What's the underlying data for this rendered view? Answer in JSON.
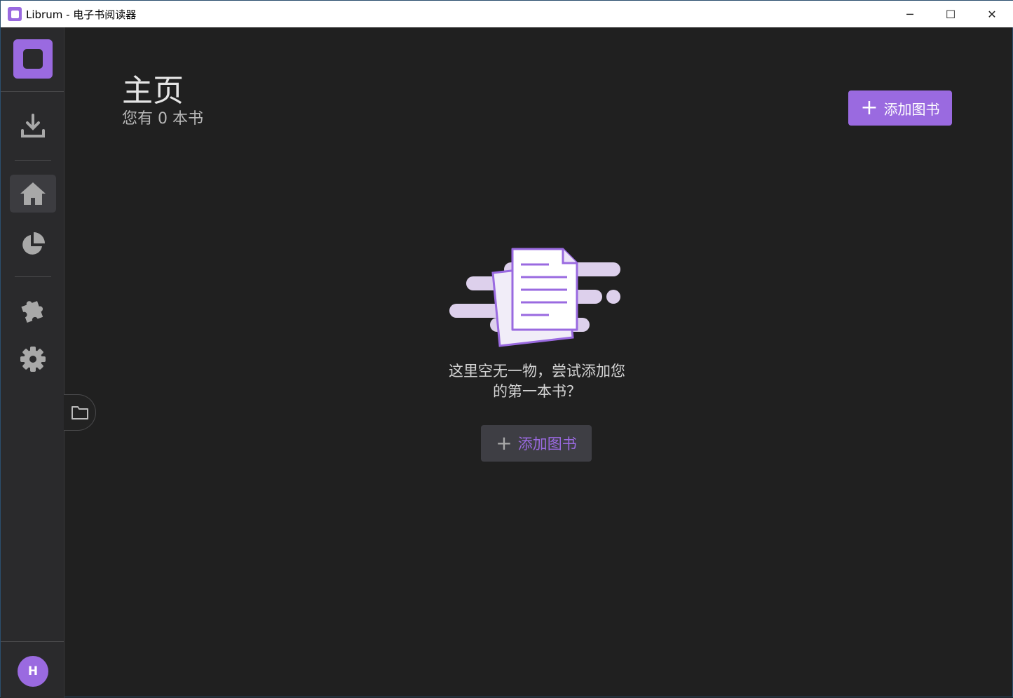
{
  "window": {
    "title": "Librum - 电子书阅读器",
    "minimize": "─",
    "maximize": "☐",
    "close": "✕"
  },
  "header": {
    "title": "主页",
    "subtitle": "您有 0 本书",
    "add_button": "添加图书"
  },
  "empty_state": {
    "line1": "这里空无一物，尝试添加您",
    "line2": "的第一本书？",
    "add_button": "添加图书"
  },
  "sidebar": {
    "avatar_initial": "H"
  },
  "colors": {
    "accent": "#9a6ae0",
    "background": "#202020",
    "sidebar": "#2a2a2c"
  }
}
